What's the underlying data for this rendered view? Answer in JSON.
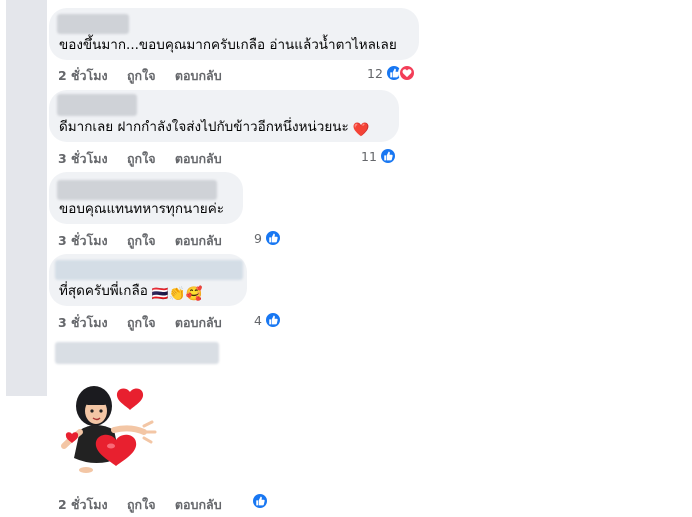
{
  "comments": [
    {
      "text": "ของขึ้นมาก...ขอบคุณมากครับเกลือ อ่านแล้วน้ำตาไหลเลย",
      "time": "2 ชั่วโมง",
      "like_label": "ถูกใจ",
      "reply_label": "ตอบกลับ",
      "reaction_count": "12",
      "reactions": [
        "like-icon",
        "love-icon"
      ]
    },
    {
      "text": "ดีมากเลย ฝากกำลังใจส่งไปกับข้าวอีกหนึ่งหน่วยนะ",
      "emoji": "❤️",
      "time": "3 ชั่วโมง",
      "like_label": "ถูกใจ",
      "reply_label": "ตอบกลับ",
      "reaction_count": "11",
      "reactions": [
        "like-icon"
      ]
    },
    {
      "text": "ขอบคุณแทนทหารทุกนายค่ะ",
      "time": "3 ชั่วโมง",
      "like_label": "ถูกใจ",
      "reply_label": "ตอบกลับ",
      "reaction_count": "9",
      "reactions": [
        "like-icon"
      ]
    },
    {
      "text": "ที่สุดครับพี่เกลือ",
      "emoji": "🇹🇭👏🥰",
      "time": "3 ชั่วโมง",
      "like_label": "ถูกใจ",
      "reply_label": "ตอบกลับ",
      "reaction_count": "4",
      "reactions": [
        "like-icon"
      ]
    },
    {
      "sticker": "girl-with-hearts-sticker",
      "time": "2 ชั่วโมง",
      "like_label": "ถูกใจ",
      "reply_label": "ตอบกลับ",
      "reactions": [
        "like-icon"
      ]
    }
  ],
  "colors": {
    "bubble": "#f0f2f5",
    "meta_text": "#65676b",
    "like_blue": "#1877f2",
    "love_red": "#f33e58"
  }
}
